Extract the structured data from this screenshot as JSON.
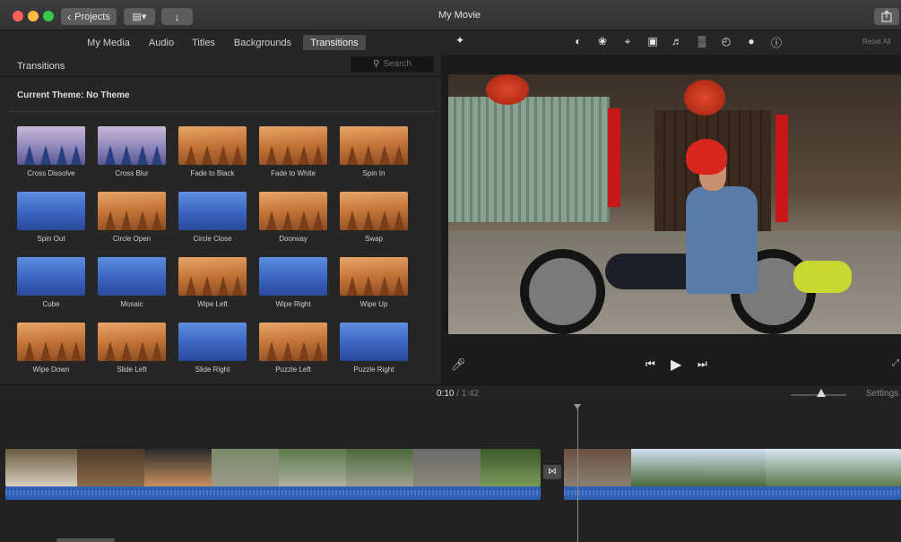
{
  "window": {
    "title": "My Movie",
    "projects_label": "Projects",
    "library_icon": "film-library-icon",
    "import_icon": "import-arrow-icon",
    "share_icon": "share-icon"
  },
  "browser_tabs": [
    {
      "label": "My Media",
      "active": false
    },
    {
      "label": "Audio",
      "active": false
    },
    {
      "label": "Titles",
      "active": false
    },
    {
      "label": "Backgrounds",
      "active": false
    },
    {
      "label": "Transitions",
      "active": true
    }
  ],
  "panel": {
    "title": "Transitions",
    "search_placeholder": "Search",
    "theme_label": "Current Theme: No Theme"
  },
  "transitions": [
    {
      "label": "Cross Dissolve",
      "style": "pale"
    },
    {
      "label": "Cross Blur",
      "style": "pale"
    },
    {
      "label": "Fade to Black",
      "style": "forest"
    },
    {
      "label": "Fade to White",
      "style": "forest"
    },
    {
      "label": "Spin In",
      "style": "forest"
    },
    {
      "label": "Spin Out",
      "style": "blue"
    },
    {
      "label": "Circle Open",
      "style": "forest"
    },
    {
      "label": "Circle Close",
      "style": "blue"
    },
    {
      "label": "Doorway",
      "style": "forest"
    },
    {
      "label": "Swap",
      "style": "forest"
    },
    {
      "label": "Cube",
      "style": "blue"
    },
    {
      "label": "Mosaic",
      "style": "blue"
    },
    {
      "label": "Wipe Left",
      "style": "forest"
    },
    {
      "label": "Wipe Right",
      "style": "blue"
    },
    {
      "label": "Wipe Up",
      "style": "forest"
    },
    {
      "label": "Wipe Down",
      "style": "forest"
    },
    {
      "label": "Slide Left",
      "style": "forest"
    },
    {
      "label": "Slide Right",
      "style": "blue"
    },
    {
      "label": "Puzzle Left",
      "style": "forest"
    },
    {
      "label": "Puzzle Right",
      "style": "blue"
    }
  ],
  "viewer": {
    "reset_all": "Reset All",
    "tools": [
      "magic-wand-icon",
      "color-balance-icon",
      "color-palette-icon",
      "crop-icon",
      "stabilization-icon",
      "volume-icon",
      "equalizer-icon",
      "speed-icon",
      "filter-icon",
      "info-icon"
    ]
  },
  "playback": {
    "mic_icon": "microphone-icon",
    "prev_icon": "skip-back-icon",
    "play_icon": "play-icon",
    "next_icon": "skip-forward-icon",
    "fullscreen_icon": "fullscreen-icon"
  },
  "timeline": {
    "current_time": "0:10",
    "separator": "/",
    "total_time": "1:42",
    "settings_label": "Settings"
  },
  "colors": {
    "accent_blue": "#2f5fb0",
    "close": "#fc605b",
    "minimize": "#fdbc40",
    "maximize": "#34c84a"
  }
}
